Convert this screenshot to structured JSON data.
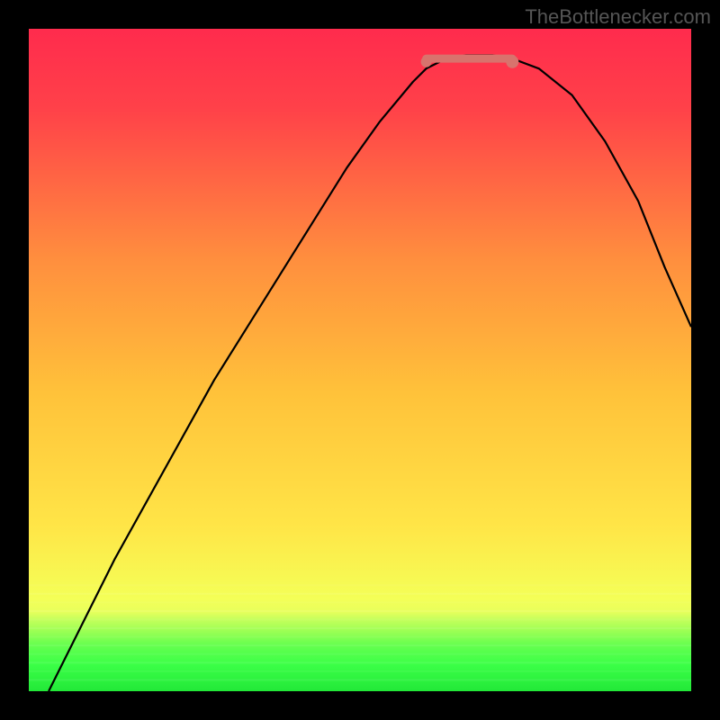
{
  "watermark": "TheBottlenecker.com",
  "chart_data": {
    "type": "line",
    "title": "",
    "xlabel": "",
    "ylabel": "",
    "xlim": [
      0,
      100
    ],
    "ylim": [
      0,
      100
    ],
    "legend": false,
    "grid": false,
    "background_gradient": {
      "top": "#ff2b4d",
      "mid": "#ffe047",
      "green_band": "#47ff47",
      "bottom_band_y_start": 88,
      "bottom_band_y_end": 100
    },
    "series": [
      {
        "name": "bottleneck-curve",
        "color": "#000000",
        "x": [
          3,
          8,
          13,
          18,
          23,
          28,
          33,
          38,
          43,
          48,
          53,
          58,
          60,
          63,
          66,
          70,
          73,
          77,
          82,
          87,
          92,
          96,
          100
        ],
        "y": [
          0,
          10,
          20,
          29,
          38,
          47,
          55,
          63,
          71,
          79,
          86,
          92,
          94,
          95.5,
          96,
          96,
          95.5,
          94,
          90,
          83,
          74,
          64,
          55
        ]
      }
    ],
    "markers": [
      {
        "name": "min-point-left",
        "x": 60,
        "y": 95,
        "color": "#d8736d",
        "r": 6
      },
      {
        "name": "min-point-right",
        "x": 73,
        "y": 95,
        "color": "#d8736d",
        "r": 7
      }
    ],
    "flat_zone": {
      "color": "#d8736d",
      "x0": 60,
      "x1": 73,
      "y": 95.5,
      "stroke_width": 9
    }
  }
}
